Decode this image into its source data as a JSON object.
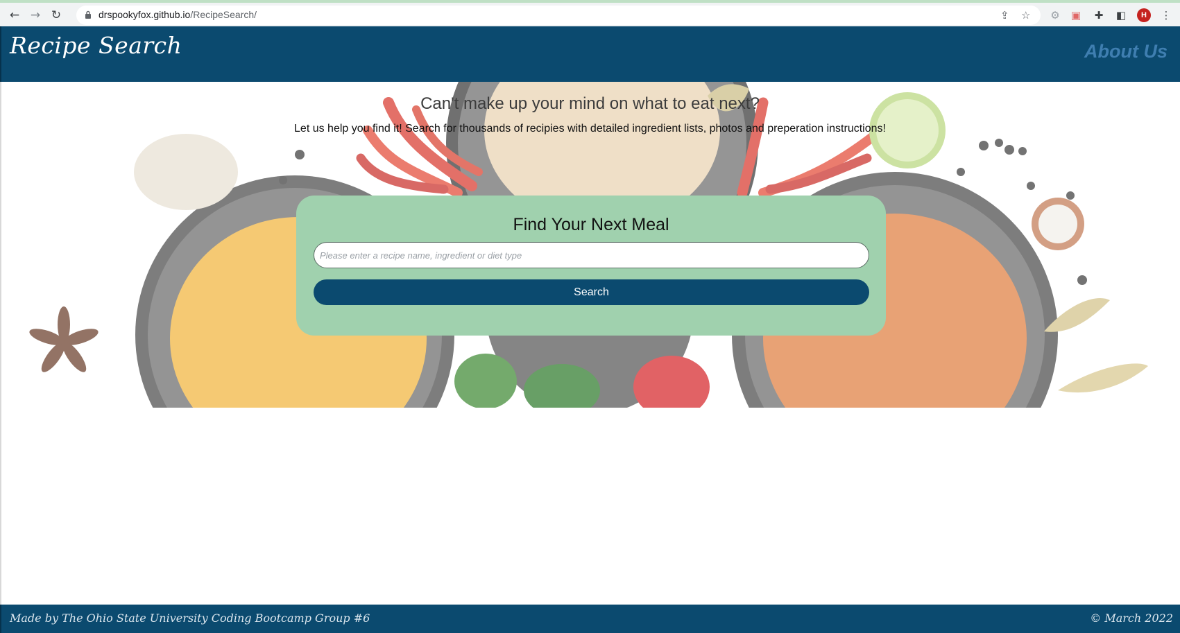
{
  "browser": {
    "url_host": "drspookyfox.github.io",
    "url_path": "/RecipeSearch/",
    "profile_initial": "H",
    "icons": [
      "back-icon",
      "forward-icon",
      "reload-icon",
      "lock-icon",
      "share-icon",
      "bookmark-star-icon",
      "extension-icon",
      "extension-record-icon",
      "puzzle-icon",
      "side-panel-icon",
      "menu-kebab-icon"
    ]
  },
  "header": {
    "brand": "Recipe Search",
    "about_link": "About Us"
  },
  "hero": {
    "title": "Can't make up your mind on what to eat next?",
    "subtitle": "Let us help you find it! Search for thousands of recipies with detailed ingredient lists, photos and preperation instructions!"
  },
  "search": {
    "heading": "Find Your Next Meal",
    "placeholder": "Please enter a recipe name, ingredient or diet type",
    "value": "",
    "button_label": "Search"
  },
  "footer": {
    "left_text": "Made by The Ohio State University Coding Bootcamp Group #6",
    "right_text": "© March 2022"
  },
  "colors": {
    "brand_navy": "#0b4a6f",
    "card_green": "#a0d1ae",
    "about_link": "#3f7eb0"
  }
}
